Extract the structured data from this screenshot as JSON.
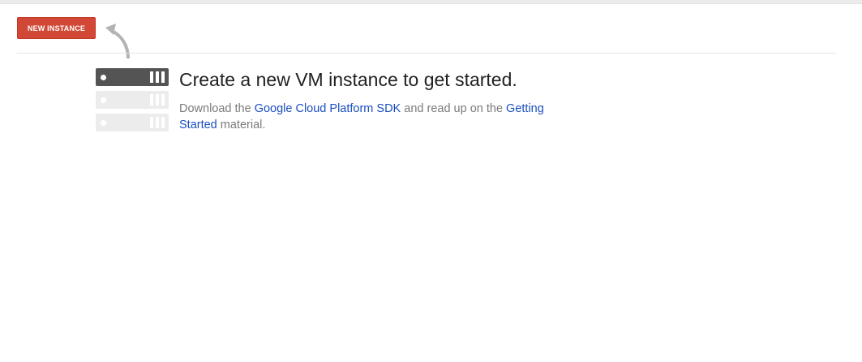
{
  "toolbar": {
    "new_instance_label": "NEW INSTANCE"
  },
  "empty_state": {
    "title": "Create a new VM instance to get started.",
    "desc_part1": "Download the ",
    "sdk_link": "Google Cloud Platform SDK",
    "desc_part2": " and read up on the ",
    "getting_started_link": "Getting Started",
    "desc_part3": " material."
  },
  "colors": {
    "button_red": "#d14836",
    "link_blue": "#1a4fbf",
    "server_dark": "#545454",
    "server_light": "#ececec"
  },
  "icons": {
    "arrow": "curved-arrow-icon",
    "servers": "server-stack-icon"
  }
}
